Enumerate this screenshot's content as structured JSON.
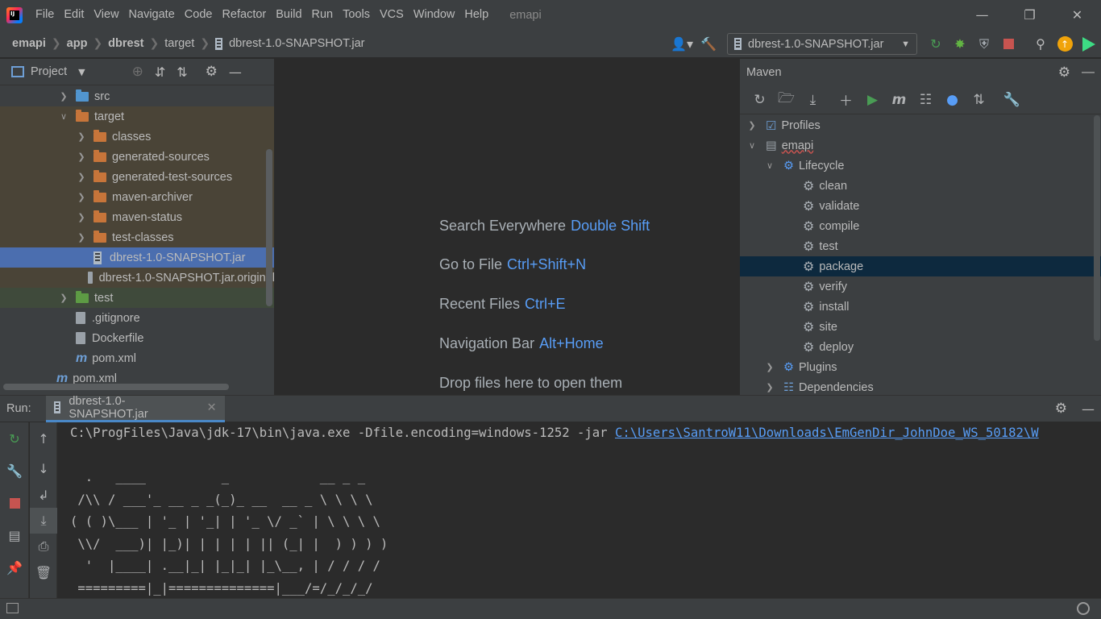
{
  "window": {
    "project_title": "emapi",
    "controls": [
      "minimize",
      "restore",
      "close"
    ]
  },
  "menu": [
    "File",
    "Edit",
    "View",
    "Navigate",
    "Code",
    "Refactor",
    "Build",
    "Run",
    "Tools",
    "VCS",
    "Window",
    "Help"
  ],
  "breadcrumb": [
    "emapi",
    "app",
    "dbrest",
    "target",
    "dbrest-1.0-SNAPSHOT.jar"
  ],
  "run_config": {
    "label": "dbrest-1.0-SNAPSHOT.jar"
  },
  "project_panel": {
    "title": "Project",
    "tree": [
      {
        "label": "src",
        "indent": 1,
        "arrow": "collapsed",
        "icon": "folder-blue"
      },
      {
        "label": "target",
        "indent": 1,
        "arrow": "expanded",
        "icon": "folder-orange"
      },
      {
        "label": "classes",
        "indent": 2,
        "arrow": "collapsed",
        "icon": "folder-orange"
      },
      {
        "label": "generated-sources",
        "indent": 2,
        "arrow": "collapsed",
        "icon": "folder-orange"
      },
      {
        "label": "generated-test-sources",
        "indent": 2,
        "arrow": "collapsed",
        "icon": "folder-orange"
      },
      {
        "label": "maven-archiver",
        "indent": 2,
        "arrow": "collapsed",
        "icon": "folder-orange"
      },
      {
        "label": "maven-status",
        "indent": 2,
        "arrow": "collapsed",
        "icon": "folder-orange"
      },
      {
        "label": "test-classes",
        "indent": 2,
        "arrow": "collapsed",
        "icon": "folder-orange"
      },
      {
        "label": "dbrest-1.0-SNAPSHOT.jar",
        "indent": 2,
        "arrow": "none",
        "icon": "jar",
        "selected": true
      },
      {
        "label": "dbrest-1.0-SNAPSHOT.jar.original",
        "indent": 2,
        "arrow": "none",
        "icon": "unknown-file"
      },
      {
        "label": "test",
        "indent": 1,
        "arrow": "collapsed",
        "icon": "folder-green"
      },
      {
        "label": ".gitignore",
        "indent": 1,
        "arrow": "none",
        "icon": "file"
      },
      {
        "label": "Dockerfile",
        "indent": 1,
        "arrow": "none",
        "icon": "file"
      },
      {
        "label": "pom.xml",
        "indent": 1,
        "arrow": "none",
        "icon": "maven"
      },
      {
        "label": "pom.xml",
        "indent": 0,
        "arrow": "none",
        "icon": "maven"
      }
    ]
  },
  "editor_hints": [
    {
      "text": "Search Everywhere",
      "key": "Double Shift"
    },
    {
      "text": "Go to File",
      "key": "Ctrl+Shift+N"
    },
    {
      "text": "Recent Files",
      "key": "Ctrl+E"
    },
    {
      "text": "Navigation Bar",
      "key": "Alt+Home"
    },
    {
      "text": "Drop files here to open them",
      "key": ""
    }
  ],
  "maven_panel": {
    "title": "Maven",
    "tree": [
      {
        "label": "Profiles",
        "indent": 0,
        "arrow": "collapsed"
      },
      {
        "label": "emapi",
        "indent": 0,
        "arrow": "expanded"
      },
      {
        "label": "Lifecycle",
        "indent": 1,
        "arrow": "expanded"
      },
      {
        "label": "clean",
        "indent": 2,
        "arrow": "none"
      },
      {
        "label": "validate",
        "indent": 2,
        "arrow": "none"
      },
      {
        "label": "compile",
        "indent": 2,
        "arrow": "none"
      },
      {
        "label": "test",
        "indent": 2,
        "arrow": "none"
      },
      {
        "label": "package",
        "indent": 2,
        "arrow": "none",
        "selected": true
      },
      {
        "label": "verify",
        "indent": 2,
        "arrow": "none"
      },
      {
        "label": "install",
        "indent": 2,
        "arrow": "none"
      },
      {
        "label": "site",
        "indent": 2,
        "arrow": "none"
      },
      {
        "label": "deploy",
        "indent": 2,
        "arrow": "none"
      },
      {
        "label": "Plugins",
        "indent": 1,
        "arrow": "collapsed"
      },
      {
        "label": "Dependencies",
        "indent": 1,
        "arrow": "collapsed"
      }
    ]
  },
  "run_panel": {
    "label": "Run:",
    "tab_label": "dbrest-1.0-SNAPSHOT.jar",
    "command_prefix": "C:\\ProgFiles\\Java\\jdk-17\\bin\\java.exe -Dfile.encoding=windows-1252 -jar ",
    "command_link": "C:\\Users\\SantroW11\\Downloads\\EmGenDir_JohnDoe_WS_50182\\W",
    "banner": [
      "",
      "  .   ____          _            __ _ _",
      " /\\\\ / ___'_ __ _ _(_)_ __  __ _ \\ \\ \\ \\",
      "( ( )\\___ | '_ | '_| | '_ \\/ _` | \\ \\ \\ \\",
      " \\\\/  ___)| |_)| | | | | || (_| |  ) ) ) )",
      "  '  |____| .__|_| |_|_| |_\\__, | / / / /",
      " =========|_|==============|___/=/_/_/_/"
    ]
  },
  "colors": {
    "selection": "#4b6eaf",
    "maven_selection": "#0d293e",
    "link": "#589df6",
    "run_green": "#499c54",
    "stop_red": "#c75450"
  }
}
